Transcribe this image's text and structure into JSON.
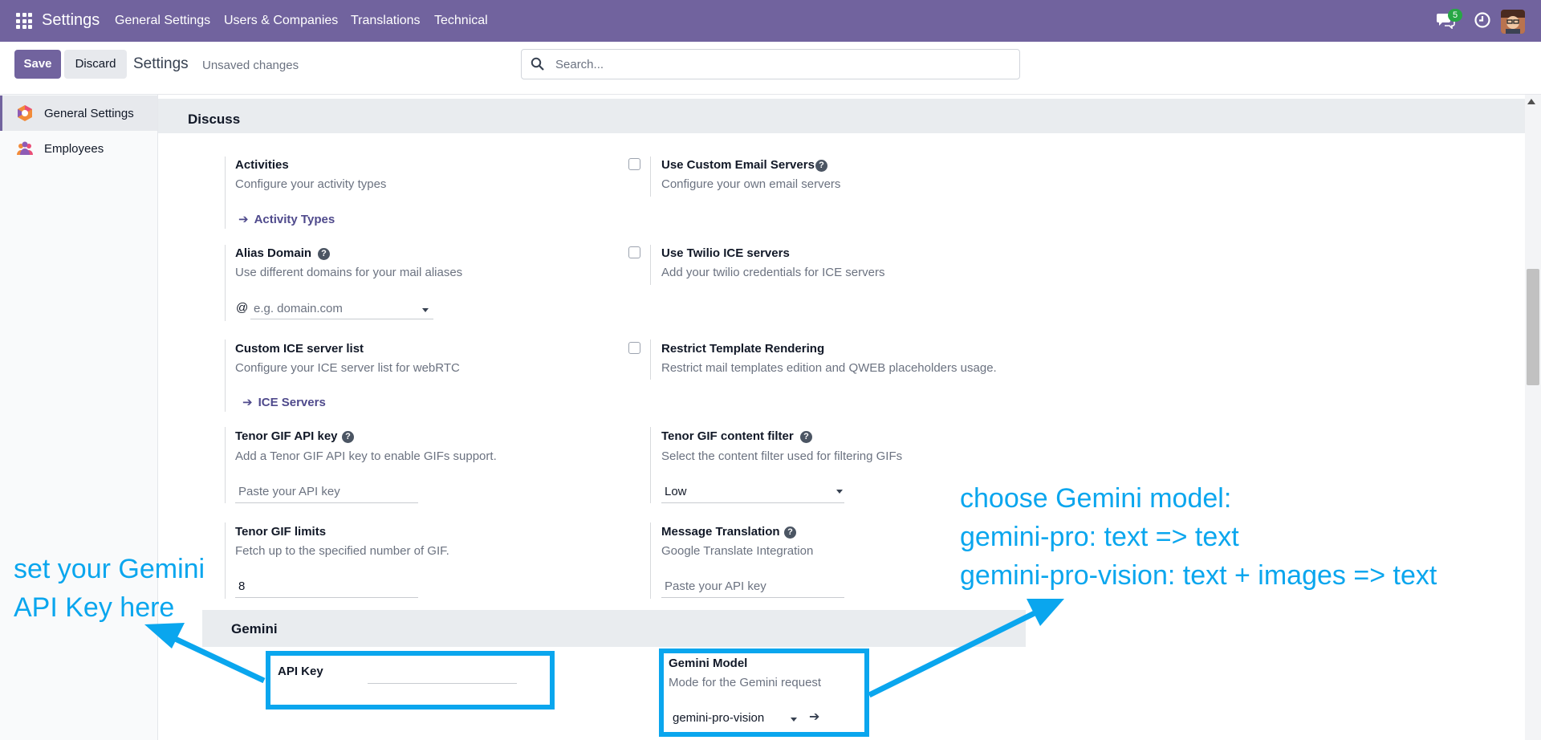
{
  "navbar": {
    "app_name": "Settings",
    "menus": [
      "General Settings",
      "Users & Companies",
      "Translations",
      "Technical"
    ],
    "chat_badge": "5",
    "icons": [
      "apps-grid-icon",
      "chat-icon",
      "clock-icon",
      "avatar"
    ]
  },
  "control_panel": {
    "save_label": "Save",
    "discard_label": "Discard",
    "breadcrumb_title": "Settings",
    "status": "Unsaved changes",
    "search_placeholder": "Search..."
  },
  "sidebar": {
    "items": [
      {
        "label": "General Settings",
        "icon": "general-settings-icon",
        "active": true
      },
      {
        "label": "Employees",
        "icon": "employees-icon",
        "active": false
      }
    ]
  },
  "discuss": {
    "heading": "Discuss",
    "activities": {
      "title": "Activities",
      "desc": "Configure your activity types",
      "link": "Activity Types"
    },
    "custom_email": {
      "title": "Use Custom Email Servers",
      "desc": "Configure your own email servers"
    },
    "alias_domain": {
      "title": "Alias Domain",
      "desc": "Use different domains for your mail aliases",
      "prefix": "@",
      "placeholder": "e.g. domain.com"
    },
    "twilio": {
      "title": "Use Twilio ICE servers",
      "desc": "Add your twilio credentials for ICE servers"
    },
    "ice_list": {
      "title": "Custom ICE server list",
      "desc": "Configure your ICE server list for webRTC",
      "link": "ICE Servers"
    },
    "restrict_template": {
      "title": "Restrict Template Rendering",
      "desc": "Restrict mail templates edition and QWEB placeholders usage."
    },
    "tenor_key": {
      "title": "Tenor GIF API key",
      "desc": "Add a Tenor GIF API key to enable GIFs support.",
      "placeholder": "Paste your API key"
    },
    "tenor_filter": {
      "title": "Tenor GIF content filter",
      "desc": "Select the content filter used for filtering GIFs",
      "value": "Low"
    },
    "tenor_limits": {
      "title": "Tenor GIF limits",
      "desc": "Fetch up to the specified number of GIF.",
      "value": "8"
    },
    "translation": {
      "title": "Message Translation",
      "desc": "Google Translate Integration",
      "placeholder": "Paste your API key"
    }
  },
  "gemini": {
    "heading": "Gemini",
    "api_key": {
      "title": "API Key",
      "value": ""
    },
    "model": {
      "title": "Gemini Model",
      "desc": "Mode for the Gemini request",
      "value": "gemini-pro-vision"
    }
  },
  "annotations": {
    "left_line1": "set your Gemini",
    "left_line2": "API Key here",
    "right_line1": "choose Gemini model:",
    "right_line2": "gemini-pro: text => text",
    "right_line3": "gemini-pro-vision: text + images => text",
    "color": "#0aa6ee"
  },
  "colors": {
    "brand": "#71639e",
    "section_bg": "#e9ecef",
    "link": "#4f4a8c"
  }
}
